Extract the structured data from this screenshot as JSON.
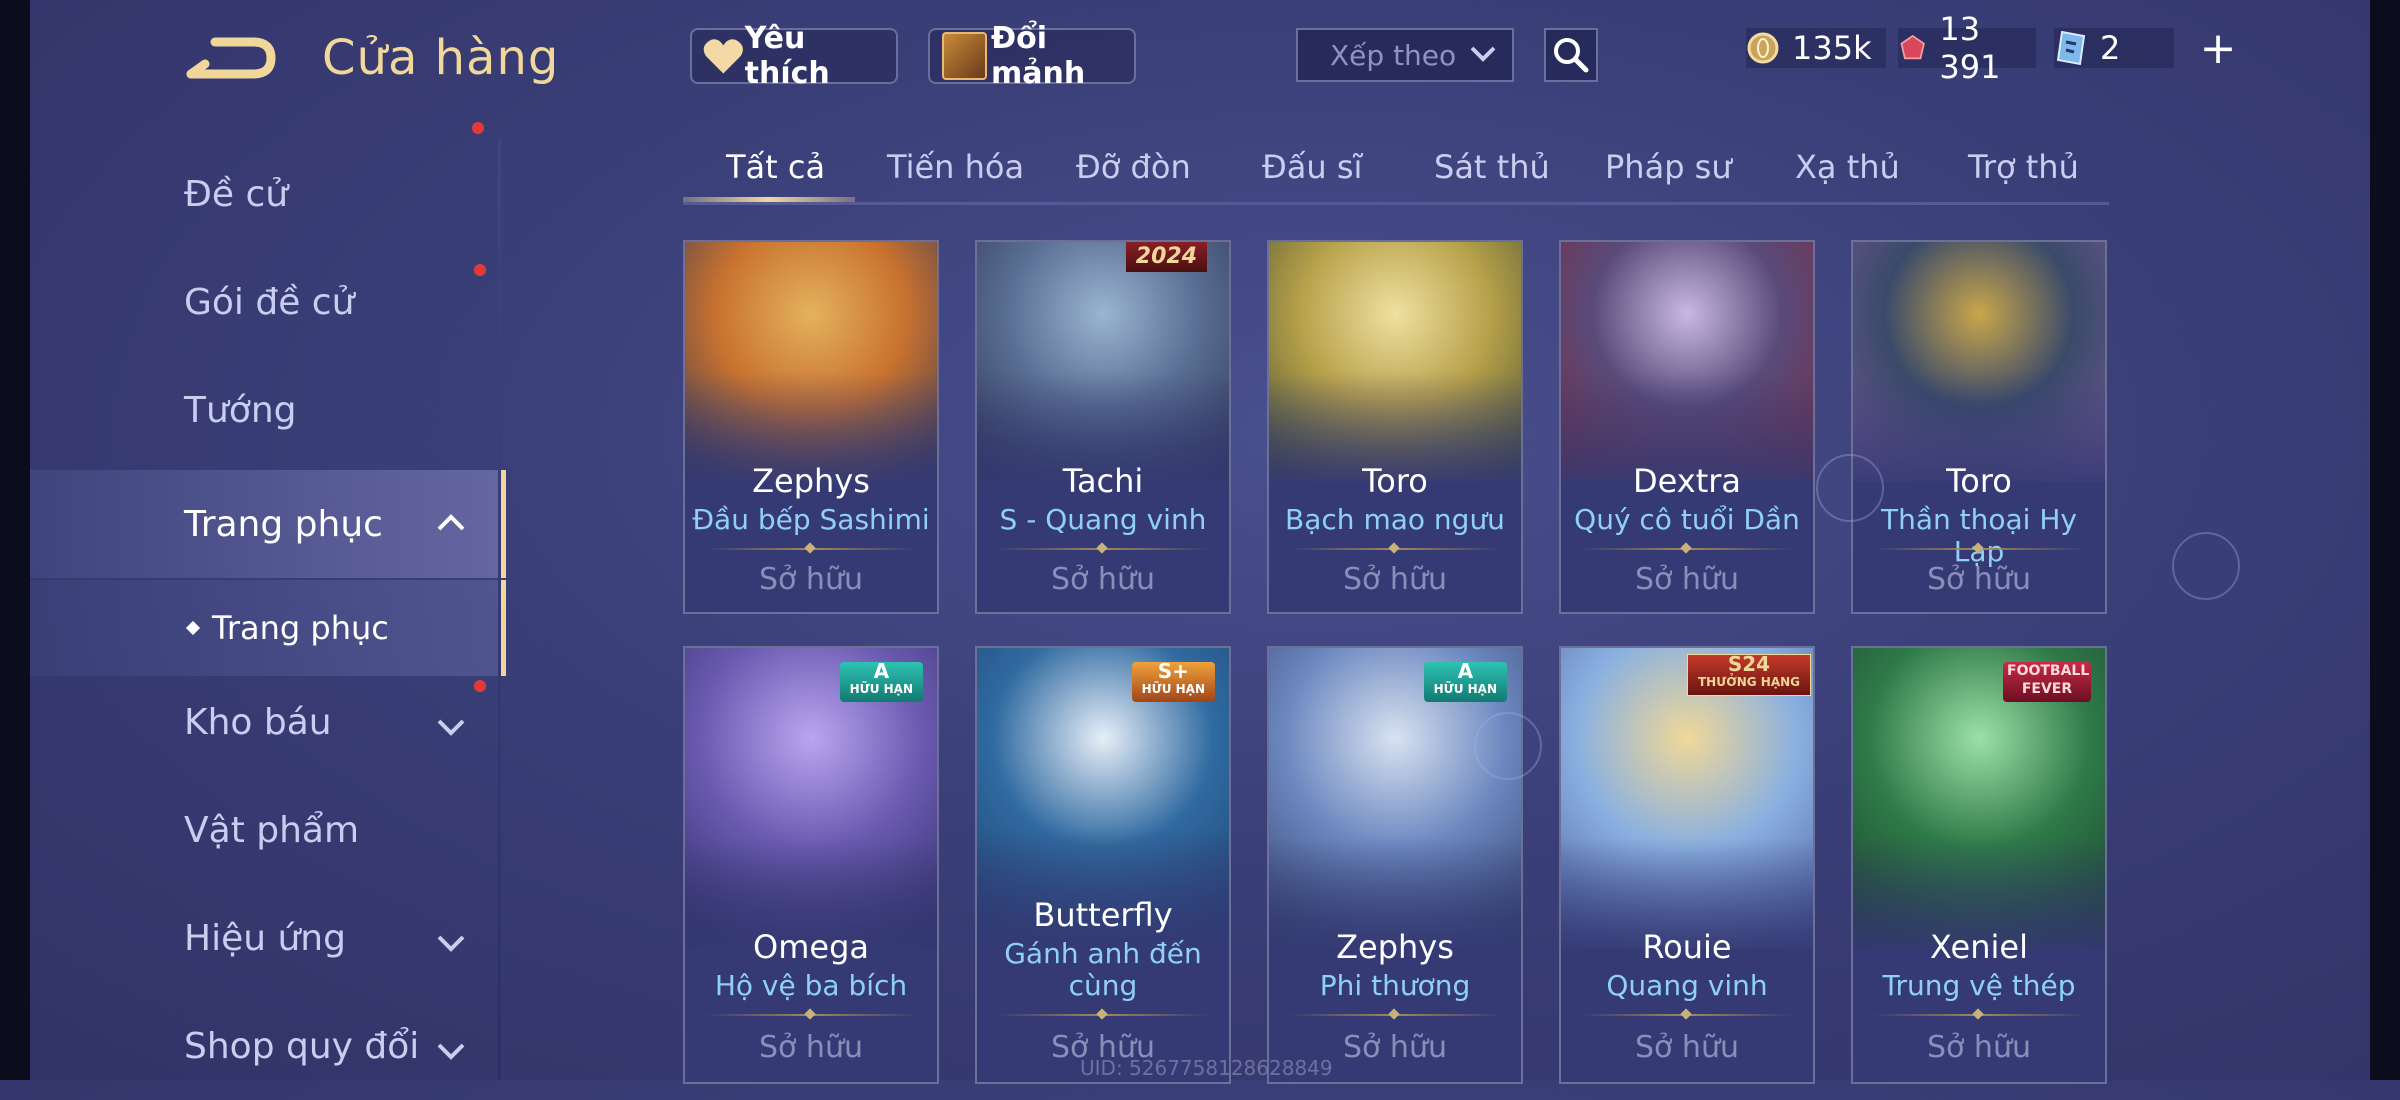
{
  "header": {
    "title": "Cửa hàng"
  },
  "topbar": {
    "favorites_label": "Yêu thích",
    "exchange_label": "Đổi mảnh",
    "sort_label": "Xếp theo",
    "gold": "135k",
    "vouchers": "13 391",
    "tickets": "2"
  },
  "sidebar": {
    "items": [
      {
        "label": "Đề cử"
      },
      {
        "label": "Gói đề cử"
      },
      {
        "label": "Tướng"
      },
      {
        "label": "Trang phục"
      },
      {
        "label": "Kho báu"
      },
      {
        "label": "Vật phẩm"
      },
      {
        "label": "Hiệu ứng"
      },
      {
        "label": "Shop quy đổi"
      }
    ],
    "sub_item": "Trang phục"
  },
  "tabs": [
    "Tất cả",
    "Tiến hóa",
    "Đỡ đòn",
    "Đấu sĩ",
    "Sát thủ",
    "Pháp sư",
    "Xạ thủ",
    "Trợ thủ"
  ],
  "cards": [
    {
      "hero": "Zephys",
      "skin": "Đầu bếp Sashimi",
      "status": "Sở hữu",
      "badge": "",
      "colors": [
        "#c9722f",
        "#e3b25e",
        "#2b3358"
      ]
    },
    {
      "hero": "Tachi",
      "skin": "S - Quang vinh",
      "status": "Sở hữu",
      "badge": "2024",
      "colors": [
        "#5a6f94",
        "#9bb4d2",
        "#2a2f4f"
      ]
    },
    {
      "hero": "Toro",
      "skin": "Bạch mao ngưu",
      "status": "Sở hữu",
      "badge": "",
      "colors": [
        "#b7a14a",
        "#efe0a0",
        "#3c4a2e"
      ]
    },
    {
      "hero": "Dextra",
      "skin": "Quý cô tuổi Dần",
      "status": "Sở hữu",
      "badge": "",
      "colors": [
        "#5a4a7a",
        "#c8b8e2",
        "#7a2a3a"
      ]
    },
    {
      "hero": "Toro",
      "skin": "Thần thoại Hy Lạp",
      "status": "Sở hữu",
      "badge": "",
      "colors": [
        "#3a4a6a",
        "#c9a64a",
        "#7a5a9a"
      ]
    },
    {
      "hero": "Omega",
      "skin": "Hộ vệ ba bích",
      "status": "Sở hữu",
      "badge": "A|HỮU HẠN",
      "colors": [
        "#6a5ab0",
        "#b9a6f0",
        "#2a2860"
      ]
    },
    {
      "hero": "Butterfly",
      "skin": "Gánh anh đến cùng",
      "status": "Sở hữu",
      "badge": "S+|HỮU HẠN",
      "colors": [
        "#2f6aa0",
        "#e7eef8",
        "#1f3a6a"
      ]
    },
    {
      "hero": "Zephys",
      "skin": "Phi thương",
      "status": "Sở hữu",
      "badge": "A|HỮU HẠN",
      "colors": [
        "#6c88c0",
        "#d8e2f0",
        "#2c3a62"
      ]
    },
    {
      "hero": "Rouie",
      "skin": "Quang vinh",
      "status": "Sở hữu",
      "badge": "S24|THƯỞNG HẠNG",
      "colors": [
        "#8ab0e0",
        "#f0d898",
        "#4a5a9a"
      ]
    },
    {
      "hero": "Xeniel",
      "skin": "Trung vệ thép",
      "status": "Sở hữu",
      "badge": "FOOTBALL FEVER",
      "colors": [
        "#2e7a48",
        "#9ce0a8",
        "#1a3a2a"
      ]
    }
  ],
  "uid": "UID: 5267758128628849"
}
